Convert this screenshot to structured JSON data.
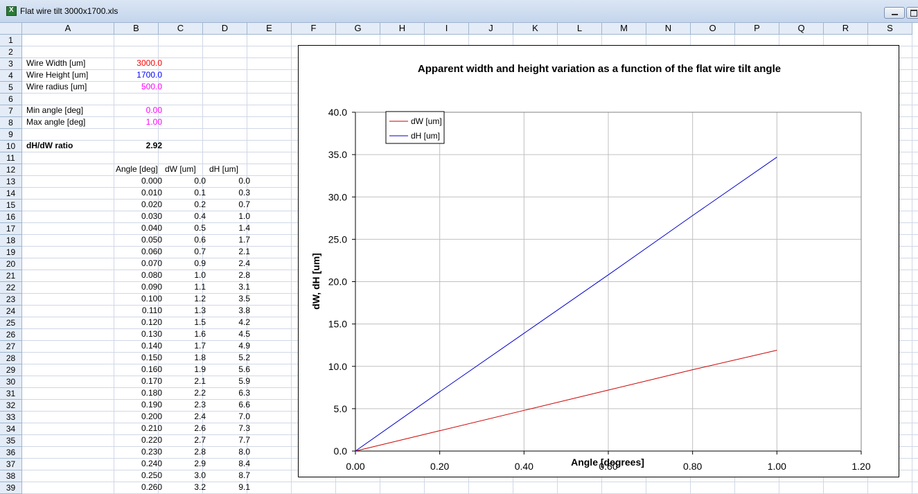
{
  "window": {
    "title": "Flat wire tilt 3000x1700.xls"
  },
  "columns": [
    "A",
    "B",
    "C",
    "D",
    "E",
    "F",
    "G",
    "H",
    "I",
    "J",
    "K",
    "L",
    "M",
    "N",
    "O",
    "P",
    "Q",
    "R",
    "S"
  ],
  "rows": [
    "1",
    "2",
    "3",
    "4",
    "5",
    "6",
    "7",
    "8",
    "9",
    "10",
    "11",
    "12",
    "13",
    "14",
    "15",
    "16",
    "17",
    "18",
    "19",
    "20",
    "21",
    "22",
    "23",
    "24",
    "25",
    "26",
    "27",
    "28",
    "29",
    "30",
    "31",
    "32",
    "33",
    "34",
    "35",
    "36",
    "37",
    "38",
    "39"
  ],
  "params": {
    "wire_width_label": "Wire Width [um]",
    "wire_width_value": "3000.0",
    "wire_height_label": "Wire Height [um]",
    "wire_height_value": "1700.0",
    "wire_radius_label": "Wire radius [um]",
    "wire_radius_value": "500.0",
    "min_angle_label": "Min angle [deg]",
    "min_angle_value": "0.00",
    "max_angle_label": "Max angle [deg]",
    "max_angle_value": "1.00",
    "ratio_label": "dH/dW ratio",
    "ratio_value": "2.92"
  },
  "colors": {
    "red": "#ff0000",
    "blue": "#0000ff",
    "magenta": "#ff00ff",
    "dW_line": "#cc0000",
    "dH_line": "#0000cc"
  },
  "table": {
    "headers": [
      "Angle [deg]",
      "dW [um]",
      "dH [um]"
    ],
    "rows": [
      [
        "0.000",
        "0.0",
        "0.0"
      ],
      [
        "0.010",
        "0.1",
        "0.3"
      ],
      [
        "0.020",
        "0.2",
        "0.7"
      ],
      [
        "0.030",
        "0.4",
        "1.0"
      ],
      [
        "0.040",
        "0.5",
        "1.4"
      ],
      [
        "0.050",
        "0.6",
        "1.7"
      ],
      [
        "0.060",
        "0.7",
        "2.1"
      ],
      [
        "0.070",
        "0.9",
        "2.4"
      ],
      [
        "0.080",
        "1.0",
        "2.8"
      ],
      [
        "0.090",
        "1.1",
        "3.1"
      ],
      [
        "0.100",
        "1.2",
        "3.5"
      ],
      [
        "0.110",
        "1.3",
        "3.8"
      ],
      [
        "0.120",
        "1.5",
        "4.2"
      ],
      [
        "0.130",
        "1.6",
        "4.5"
      ],
      [
        "0.140",
        "1.7",
        "4.9"
      ],
      [
        "0.150",
        "1.8",
        "5.2"
      ],
      [
        "0.160",
        "1.9",
        "5.6"
      ],
      [
        "0.170",
        "2.1",
        "5.9"
      ],
      [
        "0.180",
        "2.2",
        "6.3"
      ],
      [
        "0.190",
        "2.3",
        "6.6"
      ],
      [
        "0.200",
        "2.4",
        "7.0"
      ],
      [
        "0.210",
        "2.6",
        "7.3"
      ],
      [
        "0.220",
        "2.7",
        "7.7"
      ],
      [
        "0.230",
        "2.8",
        "8.0"
      ],
      [
        "0.240",
        "2.9",
        "8.4"
      ],
      [
        "0.250",
        "3.0",
        "8.7"
      ],
      [
        "0.260",
        "3.2",
        "9.1"
      ]
    ]
  },
  "chart_data": {
    "type": "line",
    "title": "Apparent width and height variation as a function of the flat wire tilt angle",
    "xlabel": "Angle [degrees]",
    "ylabel": "dW, dH [um]",
    "xlim": [
      0,
      1.2
    ],
    "ylim": [
      0,
      40
    ],
    "xticks": [
      "0.00",
      "0.20",
      "0.40",
      "0.60",
      "0.80",
      "1.00",
      "1.20"
    ],
    "yticks": [
      "0.0",
      "5.0",
      "10.0",
      "15.0",
      "20.0",
      "25.0",
      "30.0",
      "35.0",
      "40.0"
    ],
    "grid": true,
    "legend": "top-left",
    "series": [
      {
        "name": "dW [um]",
        "color": "#cc0000",
        "x": [
          0,
          0.2,
          0.4,
          0.6,
          0.8,
          1.0
        ],
        "y": [
          0,
          2.4,
          4.8,
          7.2,
          9.6,
          11.9
        ]
      },
      {
        "name": "dH [um]",
        "color": "#0000cc",
        "x": [
          0,
          0.2,
          0.4,
          0.6,
          0.8,
          1.0
        ],
        "y": [
          0,
          7.0,
          13.9,
          20.8,
          27.8,
          34.7
        ]
      }
    ]
  }
}
